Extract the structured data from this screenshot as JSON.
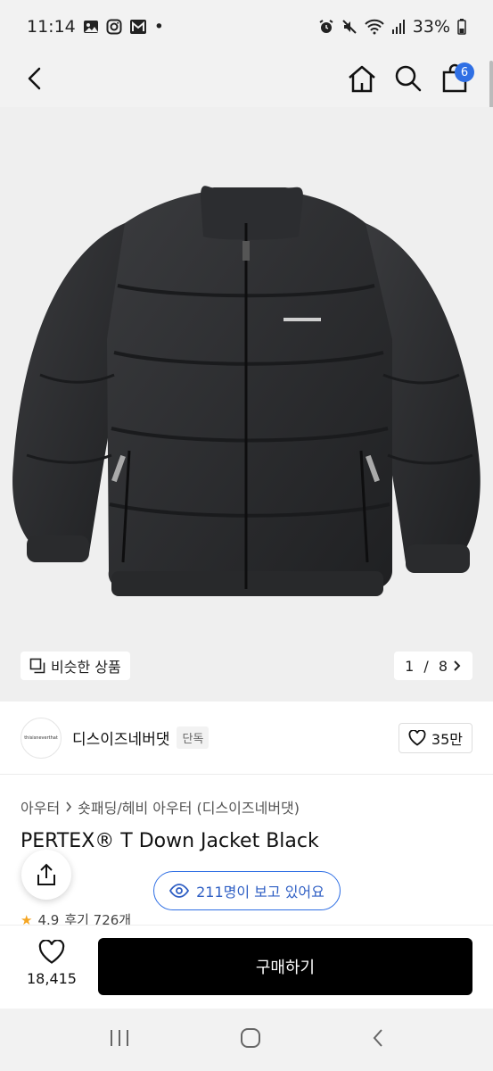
{
  "status_bar": {
    "time": "11:14",
    "dot": "•",
    "battery": "33%",
    "icons": [
      "gallery-icon",
      "instagram-icon",
      "gmail-icon",
      "alarm-icon",
      "mute-icon",
      "wifi-icon",
      "signal-icon",
      "battery-icon"
    ]
  },
  "header": {
    "cart_count": "6",
    "icons": [
      "back-icon",
      "home-icon",
      "search-icon",
      "cart-icon"
    ]
  },
  "gallery": {
    "similar_label": "비슷한 상품",
    "page_current": "1",
    "page_total": "8",
    "page_sep": " / "
  },
  "brand": {
    "name": "디스이즈네버댓",
    "tag": "단독",
    "likes": "35만",
    "logo_text": "thisisneverthat"
  },
  "product": {
    "category_1": "아우터",
    "category_2": "숏패딩/헤비 아우터 (디스이즈네버댓)",
    "title": "PERTEX® T Down Jacket Black",
    "viewers_text": "211명이 보고 있어요",
    "rating": "4.9",
    "review_text": "후기 726개"
  },
  "bottom": {
    "wish_count": "18,415",
    "buy_label": "구매하기"
  },
  "colors": {
    "accent": "#2f6fe4",
    "buy_button": "#000000",
    "jacket": "#2a2b2d"
  }
}
